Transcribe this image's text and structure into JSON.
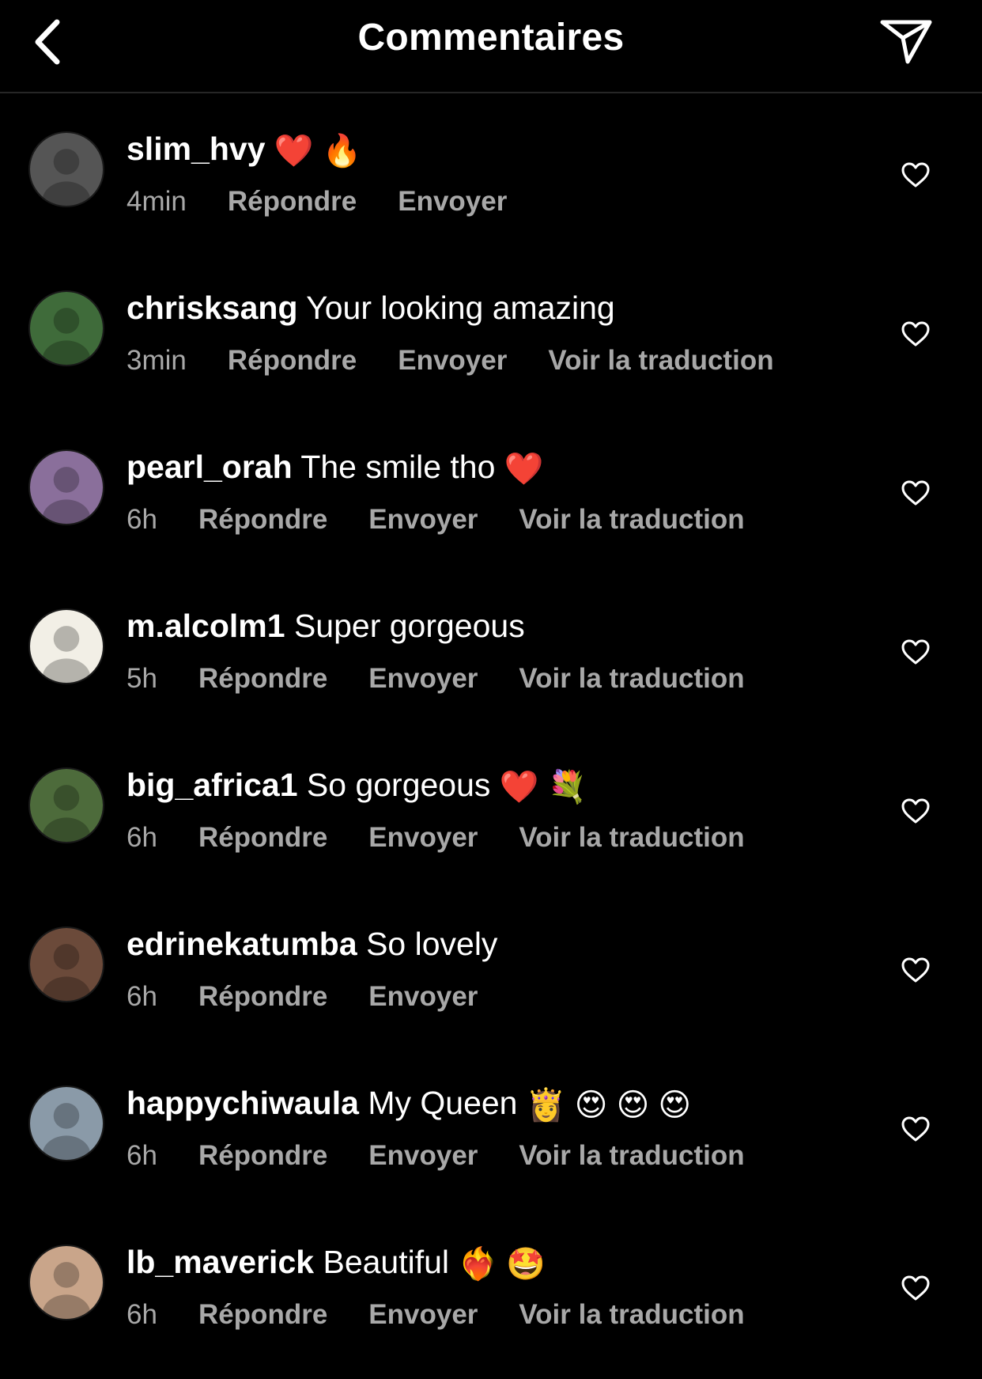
{
  "header": {
    "title": "Commentaires",
    "back_icon": "chevron-left-icon",
    "send_icon": "paper-plane-icon"
  },
  "actions": {
    "reply": "Répondre",
    "send": "Envoyer",
    "translate": "Voir la traduction"
  },
  "comments": [
    {
      "username": "slim_hvy",
      "text": "",
      "emoji": "❤️ 🔥",
      "time": "4min",
      "translate": false,
      "avatar_color": "#555555"
    },
    {
      "username": "chrisksang",
      "text": "Your looking amazing",
      "emoji": "",
      "time": "3min",
      "translate": true,
      "avatar_color": "#3f6b3a"
    },
    {
      "username": "pearl_orah",
      "text": "The smile tho",
      "emoji": "❤️",
      "time": "6h",
      "translate": true,
      "avatar_color": "#8a6f9b"
    },
    {
      "username": "m.alcolm1",
      "text": "Super gorgeous",
      "emoji": "",
      "time": "5h",
      "translate": true,
      "avatar_color": "#f2efe6"
    },
    {
      "username": "big_africa1",
      "text": "So gorgeous",
      "emoji": "❤️ 💐",
      "time": "6h",
      "translate": true,
      "avatar_color": "#4d6b3b"
    },
    {
      "username": "edrinekatumba",
      "text": "So lovely",
      "emoji": "",
      "time": "6h",
      "translate": false,
      "avatar_color": "#6b4a3a"
    },
    {
      "username": "happychiwaula",
      "text": "My Queen",
      "emoji": "👸 😍 😍 😍",
      "time": "6h",
      "translate": true,
      "avatar_color": "#8a9aa8"
    },
    {
      "username": "lb_maverick",
      "text": "Beautiful",
      "emoji": "❤️‍🔥 🤩",
      "time": "6h",
      "translate": true,
      "avatar_color": "#c9a58a"
    }
  ],
  "colors": {
    "background": "#000000",
    "text": "#ffffff",
    "secondary": "#a8a8a8",
    "divider": "#262626"
  }
}
